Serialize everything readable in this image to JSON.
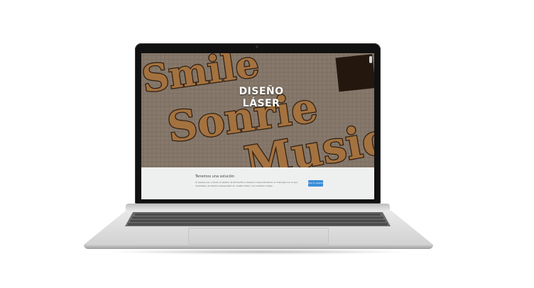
{
  "hero": {
    "title_line1": "DISEÑO",
    "title_line2": "LÁSER",
    "signs": [
      "Smile",
      "Sonrie",
      "Music"
    ]
  },
  "banner": {
    "heading": "Tenemos una solución",
    "body": "Si quieres ver y hacer tu pedido de forma fácil, desde tu casa mándanos un mensaje con lo que necesitas y te damos presupuesto en nuestro taller con nuestros codigo.",
    "button_label": "Haz tu pedido"
  },
  "colors": {
    "button": "#3b8ed8",
    "banner_bg": "#eef0f0",
    "wood": "#c88b4e"
  }
}
